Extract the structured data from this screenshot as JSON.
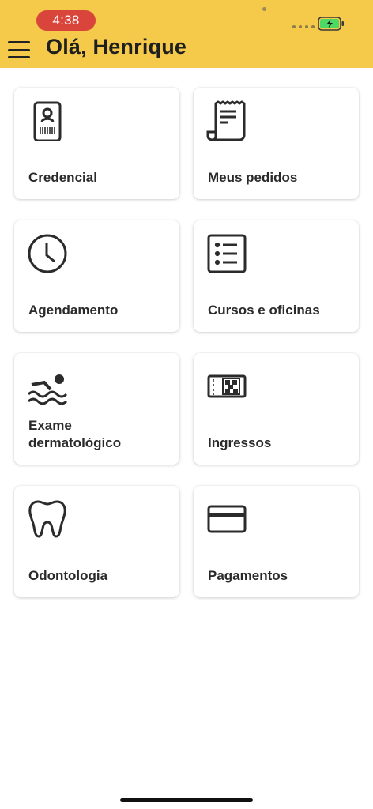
{
  "status_bar": {
    "time": "4:38"
  },
  "header": {
    "title": "Olá, Henrique"
  },
  "cards": [
    {
      "label": "Credencial",
      "icon": "badge-icon"
    },
    {
      "label": "Meus pedidos",
      "icon": "receipt-icon"
    },
    {
      "label": "Agendamento",
      "icon": "clock-icon"
    },
    {
      "label": "Cursos e oficinas",
      "icon": "list-icon"
    },
    {
      "label": "Exame\ndermatológico",
      "icon": "swimmer-icon"
    },
    {
      "label": "Ingressos",
      "icon": "ticket-icon"
    },
    {
      "label": "Odontologia",
      "icon": "tooth-icon"
    },
    {
      "label": "Pagamentos",
      "icon": "credit-card-icon"
    }
  ],
  "colors": {
    "header_bg": "#f5c94a",
    "time_pill": "#d9453a",
    "battery_fill": "#4cd964"
  }
}
